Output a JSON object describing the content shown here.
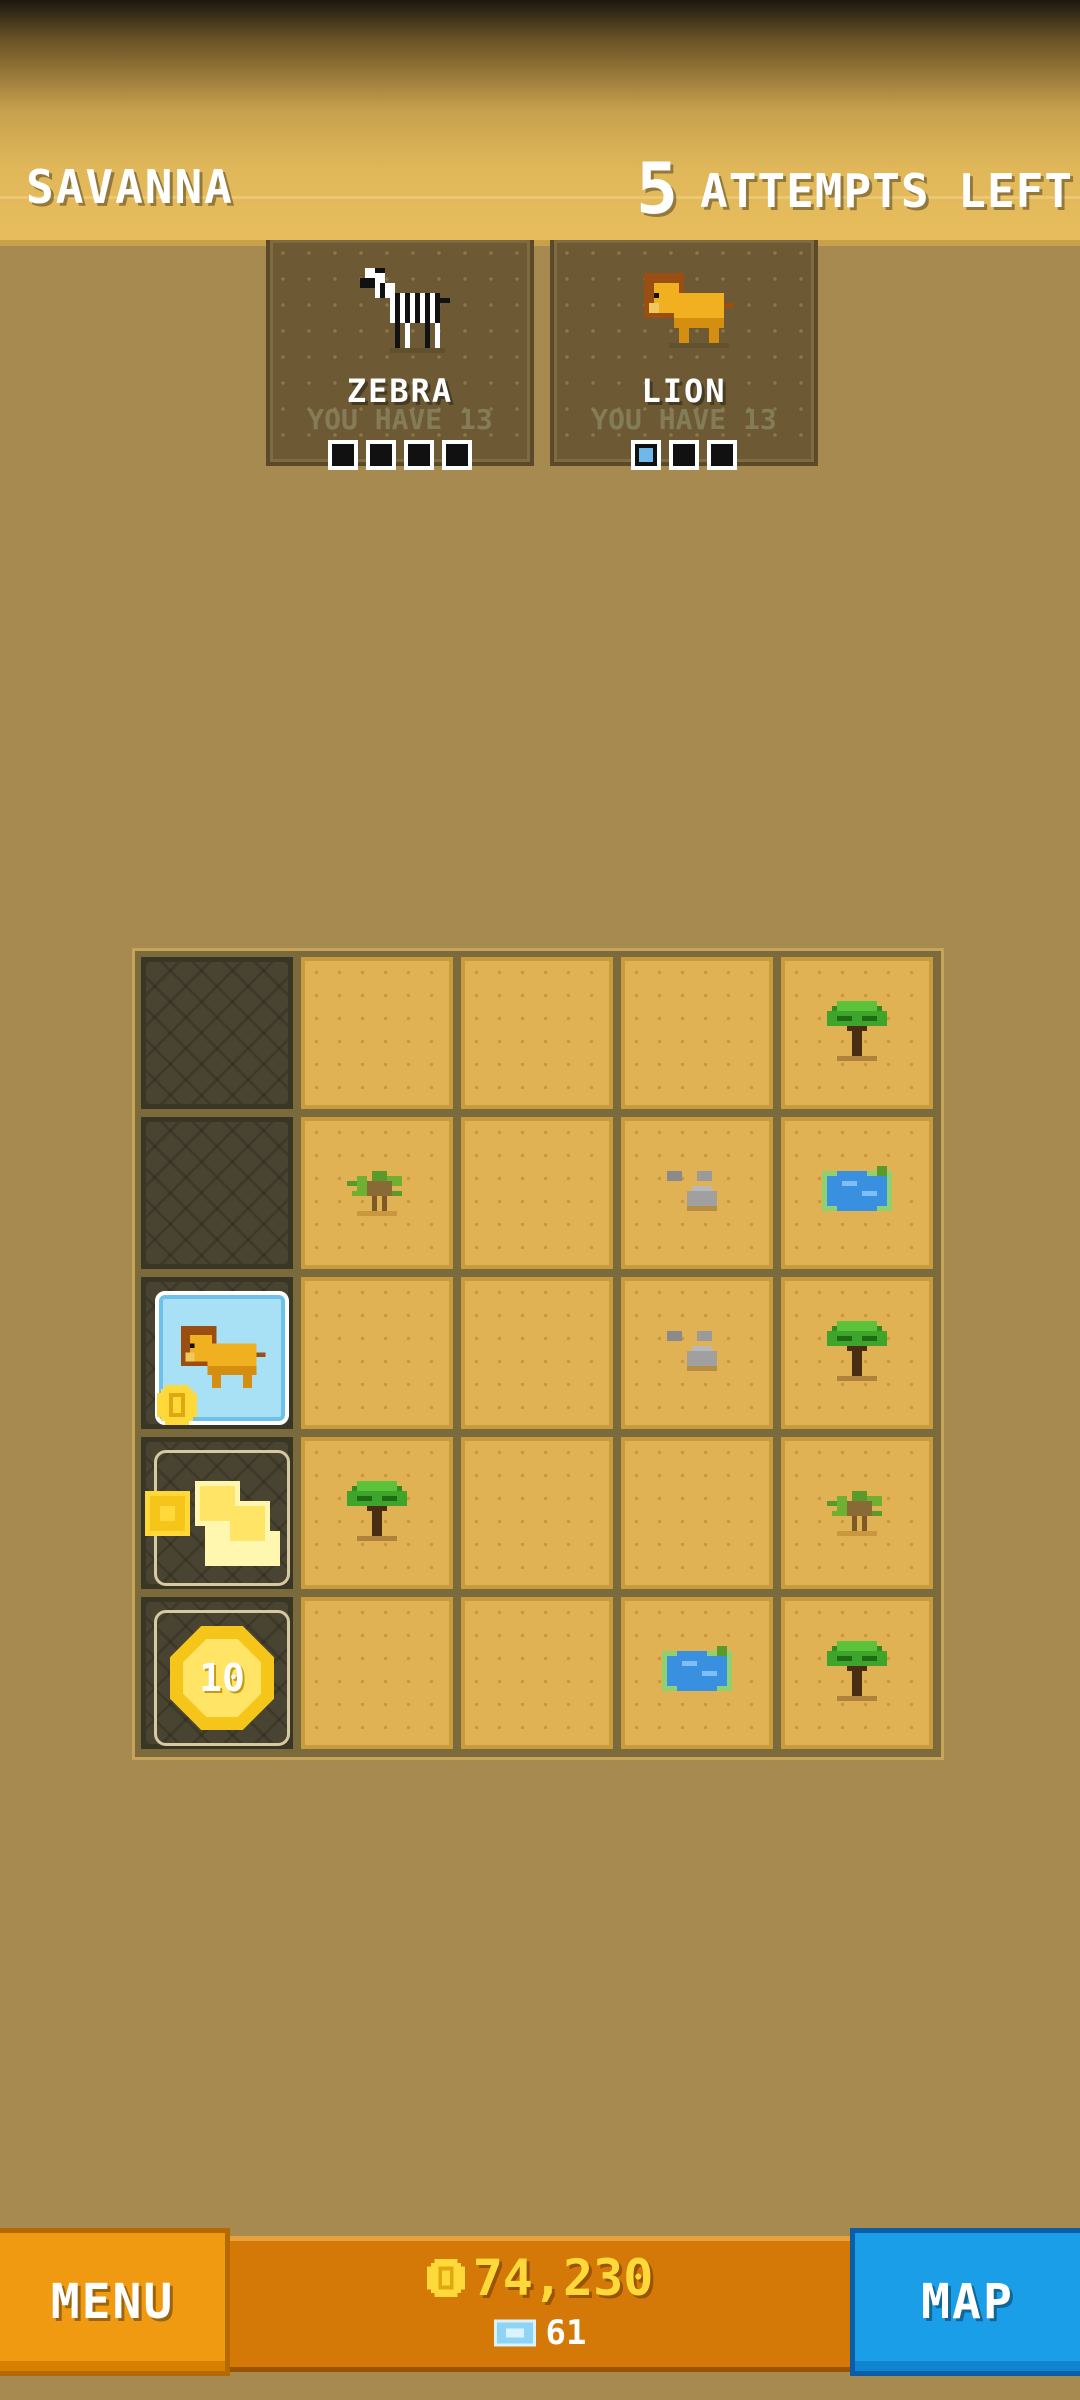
{
  "header": {
    "level_name": "SAVANNA",
    "attempts_count": "5",
    "attempts_label": "ATTEMPTS LEFT"
  },
  "animals": [
    {
      "name": "ZEBRA",
      "have": "YOU HAVE 13",
      "progress_filled": 0,
      "progress_total": 4
    },
    {
      "name": "LION",
      "have": "YOU HAVE 13",
      "progress_filled": 1,
      "progress_total": 3
    }
  ],
  "grid": {
    "rows": 5,
    "cols": 5,
    "cells": [
      [
        "dark",
        "sand",
        "sand",
        "sand",
        "tree"
      ],
      [
        "dark",
        "bush",
        "sand",
        "rocks",
        "water"
      ],
      [
        "lion",
        "sand",
        "sand",
        "rocks",
        "tree"
      ],
      [
        "coins",
        "tree",
        "sand",
        "sand",
        "bush"
      ],
      [
        "coin10",
        "sand",
        "sand",
        "water",
        "tree"
      ]
    ],
    "coin_value": "10"
  },
  "footer": {
    "menu_label": "MENU",
    "map_label": "MAP",
    "coins": "74,230",
    "tickets": "61"
  },
  "colors": {
    "sand": "#e0b253",
    "background": "#a68a50",
    "menu": "#f09a12",
    "map": "#1a9ee8",
    "coin": "#ffd93a"
  }
}
